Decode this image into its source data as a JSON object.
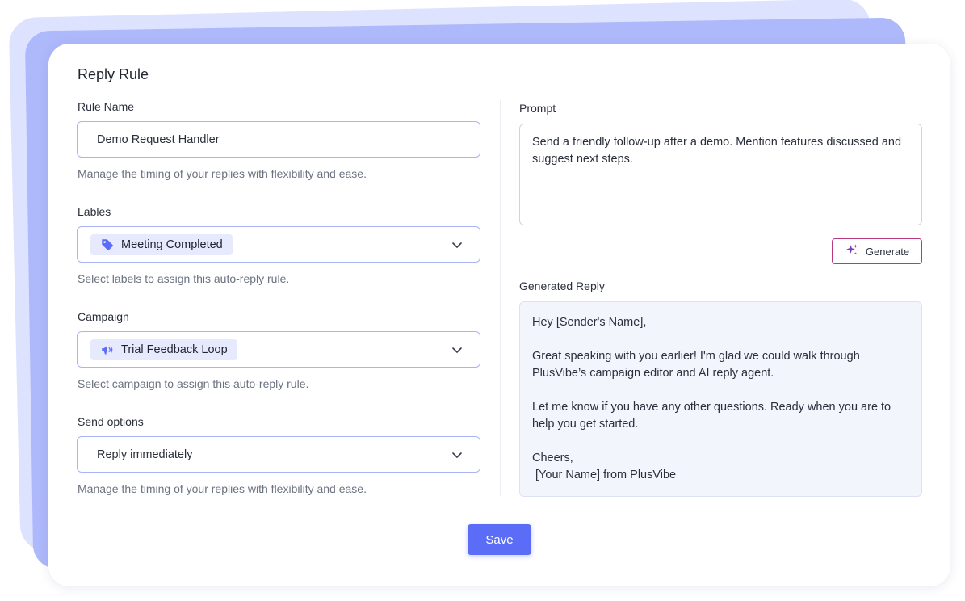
{
  "title": "Reply Rule",
  "rule_name": {
    "label": "Rule Name",
    "value": "Demo Request Handler",
    "helper": "Manage the timing of your replies with flexibility and ease."
  },
  "labels": {
    "label": "Lables",
    "selected": "Meeting Completed",
    "icon": "tag-icon",
    "helper": "Select labels to assign this auto-reply rule."
  },
  "campaign": {
    "label": "Campaign",
    "selected": "Trial Feedback Loop",
    "icon": "megaphone-icon",
    "helper": "Select campaign to assign this auto-reply rule."
  },
  "send_options": {
    "label": "Send options",
    "selected": "Reply immediately",
    "helper": "Manage the timing of your replies with flexibility and ease."
  },
  "prompt": {
    "label": "Prompt",
    "text": "Send a friendly follow-up after a demo. Mention features discussed and suggest next steps."
  },
  "generate_button": {
    "label": "Generate",
    "icon": "sparkle-icon"
  },
  "generated_reply": {
    "label": "Generated Reply",
    "paragraphs": [
      "Hey [Sender's Name],",
      "Great speaking with you earlier! I'm glad we could walk through PlusVibe’s campaign editor and AI reply agent.",
      "Let me know if you have any other questions. Ready when you are to help you get started.",
      "Cheers,",
      " [Your Name] from PlusVibe"
    ]
  },
  "save_button": {
    "label": "Save"
  },
  "colors": {
    "accent": "#5b6df7",
    "chip_bg": "#e7eafd",
    "generate_border": "#b8397d",
    "input_border": "#a9b4f6"
  }
}
